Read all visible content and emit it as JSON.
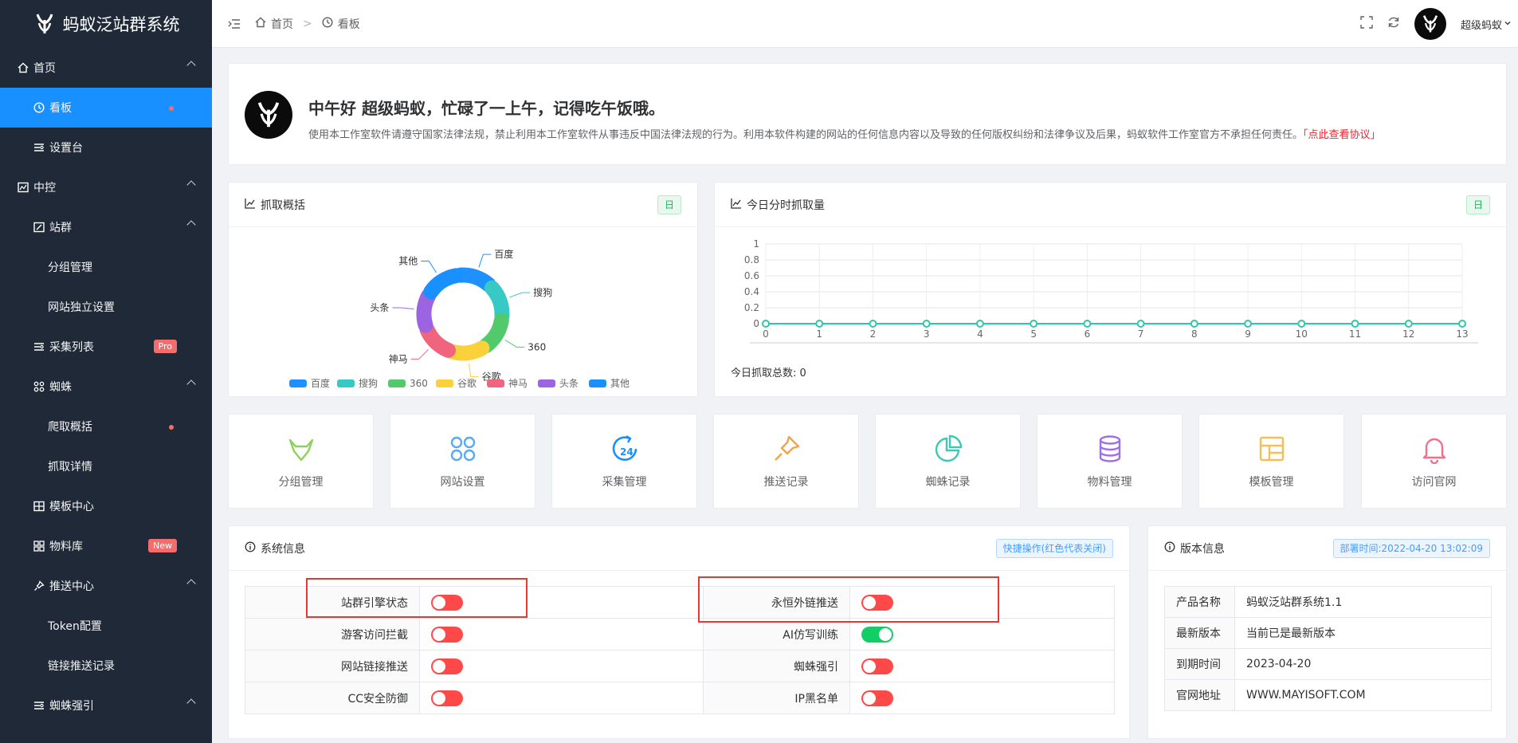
{
  "app": {
    "title": "蚂蚁泛站群系统"
  },
  "sidebar": {
    "items": [
      {
        "label": "首页"
      },
      {
        "label": "看板"
      },
      {
        "label": "设置台"
      },
      {
        "label": "中控"
      },
      {
        "label": "站群"
      },
      {
        "label": "分组管理"
      },
      {
        "label": "网站独立设置"
      },
      {
        "label": "采集列表",
        "badge": "Pro"
      },
      {
        "label": "蜘蛛"
      },
      {
        "label": "爬取概括"
      },
      {
        "label": "抓取详情"
      },
      {
        "label": "模板中心"
      },
      {
        "label": "物料库",
        "badge": "New"
      },
      {
        "label": "推送中心"
      },
      {
        "label": "Token配置"
      },
      {
        "label": "链接推送记录"
      },
      {
        "label": "蜘蛛强引"
      }
    ]
  },
  "header": {
    "breadcrumb": [
      "首页",
      "看板"
    ],
    "separator": ">",
    "username": "超级蚂蚁"
  },
  "welcome": {
    "title": "中午好 超级蚂蚁，忙碌了一上午，记得吃午饭哦。",
    "notice": "使用本工作室软件请遵守国家法律法规，禁止利用本工作室软件从事违反中国法律法规的行为。利用本软件构建的网站的任何信息内容以及导致的任何版权纠纷和法律争议及后果，蚂蚁软件工作室官方不承担任何责任。",
    "link": "「点此查看协议」"
  },
  "crawl_overview": {
    "title": "抓取概括",
    "tag": "日"
  },
  "hourly": {
    "title": "今日分时抓取量",
    "tag": "日",
    "total": "今日抓取总数: 0"
  },
  "chart_data": [
    {
      "type": "pie",
      "title": "",
      "labels": [
        "百度",
        "搜狗",
        "360",
        "谷歌",
        "神马",
        "头条",
        "其他"
      ],
      "values": [
        1,
        1,
        1,
        1,
        1,
        1,
        1
      ],
      "colors": [
        "#1e90ff",
        "#36c9c6",
        "#52c96b",
        "#fad13b",
        "#f0647d",
        "#9c64e0",
        "#1890ff"
      ],
      "legend": "bottom"
    },
    {
      "type": "line",
      "title": "",
      "x": [
        0,
        1,
        2,
        3,
        4,
        5,
        6,
        7,
        8,
        9,
        10,
        11,
        12,
        13
      ],
      "series": [
        {
          "values": [
            0,
            0,
            0,
            0,
            0,
            0,
            0,
            0,
            0,
            0,
            0,
            0,
            0,
            0
          ]
        }
      ],
      "yticks": [
        "0",
        "0.2",
        "0.4",
        "0.6",
        "0.8",
        "1"
      ],
      "ylim": [
        0,
        1
      ],
      "grid": true,
      "color": "#2ec7a9"
    }
  ],
  "shortcuts": [
    {
      "label": "分组管理",
      "icon": "gitlab-fox-icon",
      "color": "#8bd15b"
    },
    {
      "label": "网站设置",
      "icon": "command-icon",
      "color": "#5aa9f5"
    },
    {
      "label": "采集管理",
      "icon": "24h-icon",
      "color": "#1890ff"
    },
    {
      "label": "推送记录",
      "icon": "pin-icon",
      "color": "#f7a24a"
    },
    {
      "label": "蜘蛛记录",
      "icon": "pie-chart-icon",
      "color": "#3cc8b4"
    },
    {
      "label": "物料管理",
      "icon": "database-icon",
      "color": "#a06ee8"
    },
    {
      "label": "模板管理",
      "icon": "layout-icon",
      "color": "#f7bf53"
    },
    {
      "label": "访问官网",
      "icon": "bell-icon",
      "color": "#f26f8e"
    }
  ],
  "system": {
    "title": "系统信息",
    "tag": "快捷操作(红色代表关闭)",
    "rows": [
      {
        "left_label": "站群引擎状态",
        "left_on": false,
        "right_label": "永恒外链推送",
        "right_on": false
      },
      {
        "left_label": "游客访问拦截",
        "left_on": false,
        "right_label": "AI仿写训练",
        "right_on": true
      },
      {
        "left_label": "网站链接推送",
        "left_on": false,
        "right_label": "蜘蛛强引",
        "right_on": false
      },
      {
        "left_label": "CC安全防御",
        "left_on": false,
        "right_label": "IP黑名单",
        "right_on": false
      }
    ]
  },
  "version": {
    "title": "版本信息",
    "tag": "部署时间:2022-04-20 13:02:09",
    "rows": [
      {
        "label": "产品名称",
        "value": "蚂蚁泛站群系统1.1"
      },
      {
        "label": "最新版本",
        "value": "当前已是最新版本"
      },
      {
        "label": "到期时间",
        "value": "2023-04-20"
      },
      {
        "label": "官网地址",
        "value": "WWW.MAYISOFT.COM"
      }
    ]
  }
}
